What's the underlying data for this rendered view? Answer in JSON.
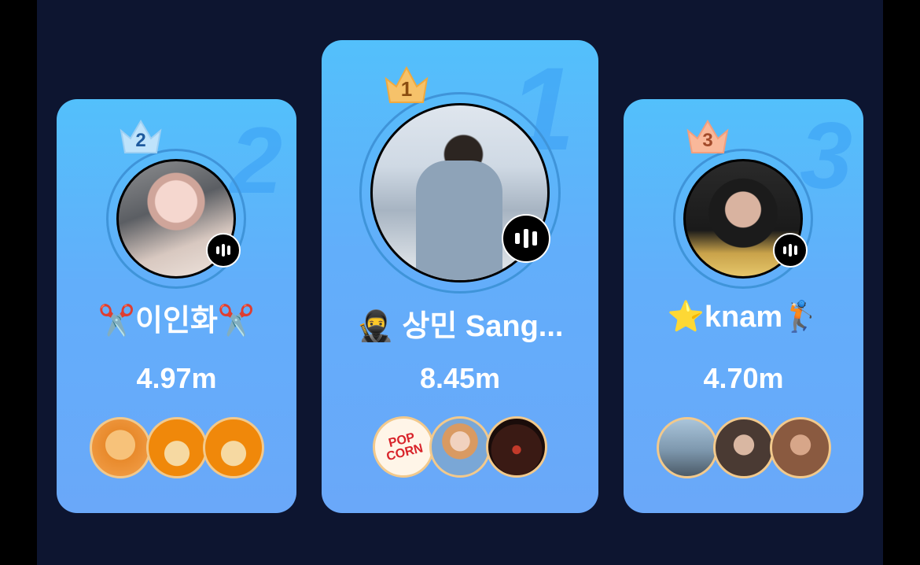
{
  "leaderboard": {
    "cards": [
      {
        "rank": "2",
        "rank_bg": "2",
        "name": "✂️이인화✂️",
        "score": "4.97m",
        "avatar_icon": "user-photo",
        "crown_color": "#bfe3fb",
        "supporters": [
          {
            "icon": "cartoon-cat",
            "bg": "#f19a3e"
          },
          {
            "icon": "detective-mascot",
            "bg": "#f0880a"
          },
          {
            "icon": "detective-mascot",
            "bg": "#f0880a"
          }
        ]
      },
      {
        "rank": "1",
        "rank_bg": "1",
        "name": "🥷 상민 Sang...",
        "score": "8.45m",
        "avatar_icon": "user-photo",
        "crown_color": "#f6c26a",
        "supporters": [
          {
            "icon": "popcorn",
            "label": "POP CORN",
            "bg": "#fff5e8"
          },
          {
            "icon": "doll-photo",
            "bg": "#7aa7d6"
          },
          {
            "icon": "painted-face",
            "bg": "#3a1a14"
          }
        ]
      },
      {
        "rank": "3",
        "rank_bg": "3",
        "name": "⭐knam🏌🏻",
        "score": "4.70m",
        "avatar_icon": "user-photo",
        "crown_color": "#f9b89a",
        "supporters": [
          {
            "icon": "street-photo",
            "bg": "#8fb0c8"
          },
          {
            "icon": "woman-photo",
            "bg": "#4a3a33"
          },
          {
            "icon": "woman-photo",
            "bg": "#8a5a40"
          }
        ]
      }
    ]
  }
}
